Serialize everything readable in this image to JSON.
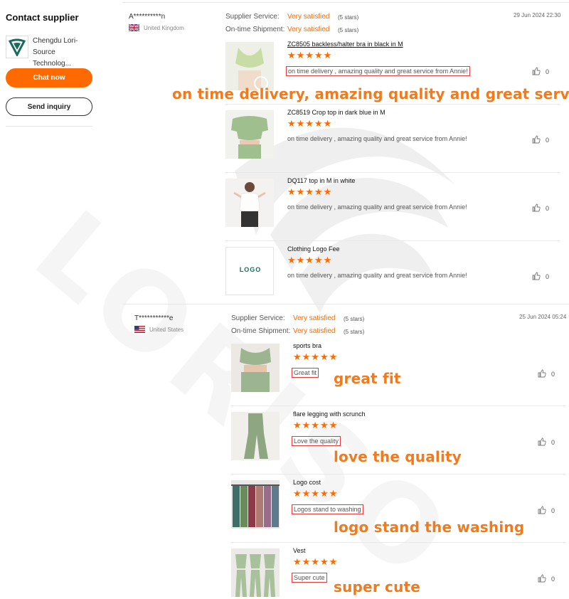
{
  "sidebar": {
    "title": "Contact supplier",
    "company_name": "Chengdu Lori-Source Technolog...",
    "chat_label": "Chat now",
    "inquiry_label": "Send inquiry"
  },
  "watermark_text": "LORISO",
  "reviews": [
    {
      "user": "A**********n",
      "country": "United Kingdom",
      "flag": "uk-flag-icon",
      "supplier_service_label": "Supplier Service:",
      "supplier_service_value": "Very satisfied",
      "supplier_service_stars": "(5 stars)",
      "ontime_label": "On-time Shipment:",
      "ontime_value": "Very satisfied",
      "ontime_stars": "(5 stars)",
      "date": "29 Jun 2024 22:30",
      "items": [
        {
          "title": "ZC8505 backless/halter bra in black in M",
          "stars": "★★★★★",
          "rating": 5,
          "comment": "on time delivery , amazing quality and great service from Annie!",
          "likes": "0",
          "image": "green-sports-bra-photo"
        },
        {
          "title": "ZC8519 Crop top in dark blue in M",
          "stars": "★★★★★",
          "rating": 5,
          "comment": "on time delivery , amazing quality and great service from Annie!",
          "likes": "0",
          "image": "green-crop-top-photo"
        },
        {
          "title": "DQ117 top in M in white",
          "stars": "★★★★★",
          "rating": 5,
          "comment": "on time delivery , amazing quality and great service from Annie!",
          "likes": "0",
          "image": "white-top-photo"
        },
        {
          "title": "Clothing Logo Fee",
          "stars": "★★★★★",
          "rating": 5,
          "comment": "on time delivery , amazing quality and great service from Annie!",
          "likes": "0",
          "image": "logo-placeholder",
          "image_text": "LOGO"
        }
      ]
    },
    {
      "user": "T***********e",
      "country": "United States",
      "flag": "us-flag-icon",
      "supplier_service_label": "Supplier Service:",
      "supplier_service_value": "Very satisfied",
      "supplier_service_stars": "(5 stars)",
      "ontime_label": "On-time Shipment:",
      "ontime_value": "Very satisfied",
      "ontime_stars": "(5 stars)",
      "date": "25 Jun 2024 05:24",
      "items": [
        {
          "title": "sports bra",
          "stars": "★★★★★",
          "rating": 5,
          "comment": "Great fit",
          "likes": "0",
          "image": "sports-bra-set-photo"
        },
        {
          "title": "flare legging with scrunch",
          "stars": "★★★★★",
          "rating": 5,
          "comment": "Love the quality",
          "likes": "0",
          "image": "flare-legging-photo"
        },
        {
          "title": "Logo cost",
          "stars": "★★★★★",
          "rating": 5,
          "comment": "Logos stand to washing",
          "likes": "0",
          "image": "leggings-rack-photo"
        },
        {
          "title": "Vest",
          "stars": "★★★★★",
          "rating": 5,
          "comment": "Super cute",
          "likes": "0",
          "image": "vest-set-photo"
        }
      ]
    }
  ],
  "captions": {
    "c1": "on time delivery, amazing quality and great service",
    "c2": "great fit",
    "c3": "love the quality",
    "c4": "logo stand the washing",
    "c5": "super cute"
  },
  "colors": {
    "accent": "#ff6a00",
    "caption": "#f07b1f",
    "highlight_box": "#e03c3c"
  }
}
